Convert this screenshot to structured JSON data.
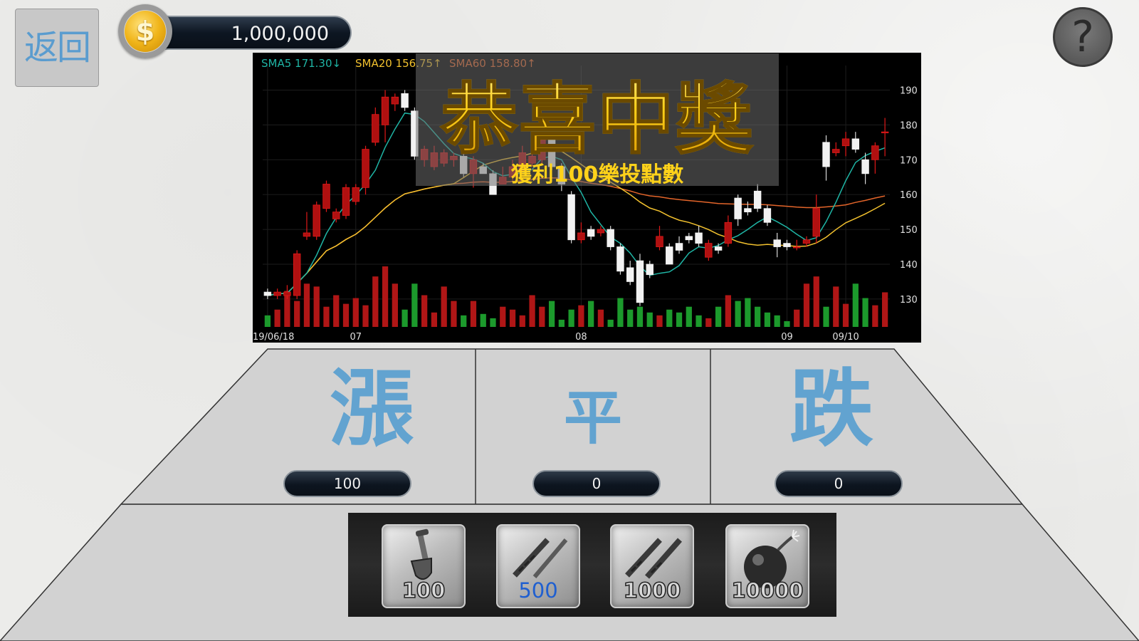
{
  "back_button": {
    "label": "返回"
  },
  "coins": {
    "amount": "1,000,000",
    "icon": "dollar-coin-icon"
  },
  "help_button": {
    "label": "?"
  },
  "chart_data": {
    "type": "candlestick",
    "indicators": [
      {
        "name": "SMA5",
        "value": "171.30",
        "trend": "↓",
        "color": "#1fb5a5"
      },
      {
        "name": "SMA20",
        "value": "156.75",
        "trend": "↑",
        "color": "#f2c12e"
      },
      {
        "name": "SMA60",
        "value": "158.80",
        "trend": "↑",
        "color": "#e4652a"
      }
    ],
    "ylim": [
      122,
      195
    ],
    "y_ticks": [
      130,
      140,
      150,
      160,
      170,
      180,
      190
    ],
    "x_labels": [
      {
        "label": "2019/06/18",
        "index": 0
      },
      {
        "label": "07",
        "index": 9
      },
      {
        "label": "08",
        "index": 32
      },
      {
        "label": "09",
        "index": 53
      },
      {
        "label": "09/10",
        "index": 59
      }
    ],
    "candles": [
      [
        132,
        131,
        133,
        130
      ],
      [
        131,
        132,
        133,
        130
      ],
      [
        131,
        132,
        134,
        130
      ],
      [
        131,
        143,
        144,
        130
      ],
      [
        148,
        149,
        155,
        147
      ],
      [
        148,
        157,
        158,
        147
      ],
      [
        156,
        163,
        164,
        155
      ],
      [
        153,
        155,
        156,
        152
      ],
      [
        154,
        162,
        163,
        153
      ],
      [
        158,
        162,
        163,
        157
      ],
      [
        162,
        173,
        174,
        160
      ],
      [
        175,
        183,
        185,
        174
      ],
      [
        180,
        188,
        190,
        175
      ],
      [
        186,
        188,
        189,
        184
      ],
      [
        189,
        185,
        190,
        184
      ],
      [
        184,
        171,
        185,
        170
      ],
      [
        170,
        173,
        174,
        168
      ],
      [
        168,
        172,
        174,
        167
      ],
      [
        169,
        172,
        173,
        168
      ],
      [
        170,
        171,
        172,
        168
      ],
      [
        171,
        166,
        172,
        165
      ],
      [
        166,
        170,
        171,
        162
      ],
      [
        168,
        166,
        169,
        166
      ],
      [
        166,
        160,
        167,
        160
      ],
      [
        163,
        165,
        168,
        163
      ],
      [
        165,
        168,
        170,
        164
      ],
      [
        167,
        172,
        174,
        166
      ],
      [
        169,
        171,
        173,
        168
      ],
      [
        170,
        176,
        177,
        169
      ],
      [
        176,
        168,
        177,
        167
      ],
      [
        168,
        163,
        169,
        161
      ],
      [
        160,
        147,
        161,
        146
      ],
      [
        147,
        149,
        152,
        146
      ],
      [
        150,
        148,
        151,
        147
      ],
      [
        149,
        150,
        151,
        148
      ],
      [
        150,
        145,
        151,
        144
      ],
      [
        145,
        138,
        146,
        137
      ],
      [
        139,
        135,
        141,
        134
      ],
      [
        141,
        129,
        143,
        128
      ],
      [
        140,
        137,
        141,
        136
      ],
      [
        145,
        148,
        151,
        144
      ],
      [
        145,
        140,
        146,
        140
      ],
      [
        146,
        144,
        148,
        143
      ],
      [
        148,
        147,
        149,
        146
      ],
      [
        149,
        146,
        151,
        145
      ],
      [
        142,
        146,
        147,
        141
      ],
      [
        145,
        144,
        146,
        143
      ],
      [
        146,
        152,
        154,
        145
      ],
      [
        159,
        153,
        160,
        151
      ],
      [
        156,
        155,
        158,
        154
      ],
      [
        161,
        156,
        163,
        155
      ],
      [
        156,
        152,
        157,
        151
      ],
      [
        147,
        145,
        149,
        142
      ],
      [
        146,
        145,
        147,
        144
      ],
      [
        145,
        145,
        147,
        144
      ],
      [
        146,
        147,
        148,
        145
      ],
      [
        148,
        156,
        160,
        146
      ],
      [
        175,
        168,
        177,
        164
      ],
      [
        172,
        173,
        175,
        171
      ],
      [
        174,
        176,
        178,
        171
      ],
      [
        176,
        173,
        178,
        172
      ],
      [
        170,
        166,
        172,
        163
      ],
      [
        170,
        174,
        175,
        166
      ],
      [
        178,
        178,
        182,
        171
      ]
    ],
    "volumes": [
      8,
      12,
      25,
      18,
      30,
      28,
      14,
      22,
      16,
      20,
      15,
      35,
      42,
      30,
      12,
      30,
      22,
      10,
      28,
      18,
      8,
      18,
      9,
      6,
      14,
      12,
      8,
      22,
      14,
      18,
      5,
      12,
      15,
      18,
      12,
      5,
      20,
      12,
      14,
      10,
      8,
      12,
      10,
      14,
      8,
      6,
      14,
      22,
      18,
      20,
      14,
      10,
      8,
      4,
      12,
      30,
      35,
      14,
      28,
      16,
      30,
      20,
      15,
      24,
      38
    ],
    "watermark": "恭喜中獎",
    "watermark_sub": "獲利100樂投點數"
  },
  "bets": [
    {
      "label": "漲",
      "amount": "100"
    },
    {
      "label": "平",
      "amount": "0"
    },
    {
      "label": "跌",
      "amount": "0"
    }
  ],
  "tools": [
    {
      "label": "100",
      "icon": "shovel-icon"
    },
    {
      "label": "500",
      "icon": "drill-icon"
    },
    {
      "label": "1000",
      "icon": "double-drill-icon"
    },
    {
      "label": "10000",
      "icon": "bomb-icon"
    }
  ]
}
